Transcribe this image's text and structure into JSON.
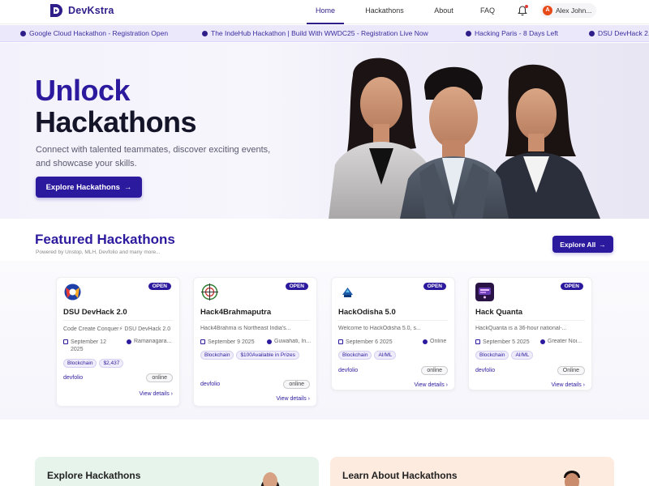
{
  "nav": {
    "brand": "DevKstra",
    "links": [
      "Home",
      "Hackathons",
      "About",
      "FAQ"
    ],
    "active": "Home",
    "user": {
      "initial": "A",
      "name": "Alex John..."
    }
  },
  "ticker": [
    "Google Cloud Hackathon - Registration Open",
    "The IndeHub Hackathon | Build With WWDC25 - Registration Live Now",
    "Hacking Paris - 8 Days Left",
    "DSU DevHack 2."
  ],
  "hero": {
    "title_line1": "Unlock",
    "title_line2": "Hackathons",
    "subtitle": "Connect with talented teammates, discover exciting events, and showcase your skills.",
    "cta": "Explore Hackathons",
    "cta_arrow": "→"
  },
  "featured": {
    "title": "Featured Hackathons",
    "subtitle": "Powered by Unstop, MLH, Devfolio and many more...",
    "explore_all": "Explore All",
    "arrow": "→"
  },
  "cards": [
    {
      "name": "DSU DevHack 2.0",
      "badge": "OPEN",
      "logo_icon": "dsu-logo-icon",
      "description": "Code Create Conquer⚡ DSU DevHack 2.0",
      "date": "September 12 2025",
      "location": "Ramanagara...",
      "tags": [
        "Blockchain",
        "$2,437"
      ],
      "platform": "devfolio",
      "mode": "online",
      "view": "View details",
      "chev": "›"
    },
    {
      "name": "Hack4Brahmaputra",
      "badge": "OPEN",
      "logo_icon": "brahmaputra-logo-icon",
      "description": "Hack4Brahma is Northeast India's...",
      "date": "September 9 2025",
      "location": "Guwahati, In...",
      "tags": [
        "Blockchain",
        "$100Available in Prizes"
      ],
      "platform": "devfolio",
      "mode": "online",
      "view": "View details",
      "chev": "›"
    },
    {
      "name": "HackOdisha 5.0",
      "badge": "OPEN",
      "logo_icon": "hackodisha-logo-icon",
      "description": "Welcome to HackOdisha 5.0, s...",
      "date": "September 6 2025",
      "location": "Online",
      "tags": [
        "Blockchain",
        "AI/ML"
      ],
      "platform": "devfolio",
      "mode": "online",
      "view": "View details",
      "chev": "›"
    },
    {
      "name": "Hack Quanta",
      "badge": "OPEN",
      "logo_icon": "hackquanta-logo-icon",
      "description": "HackQuanta is a 36-hour national-...",
      "date": "September 5 2025",
      "location": "Greater Noi...",
      "tags": [
        "Blockchain",
        "AI/ML"
      ],
      "platform": "devfolio",
      "mode": "Online",
      "view": "View details",
      "chev": "›"
    }
  ],
  "bottom": {
    "left_title": "Explore Hackathons",
    "right_title": "Learn About Hackathons"
  },
  "colors": {
    "brand": "#2c1a9e",
    "ticker_bg": "#ebe8fb",
    "explore_panel": "#e7f4ec",
    "learn_panel": "#fdebdf"
  }
}
